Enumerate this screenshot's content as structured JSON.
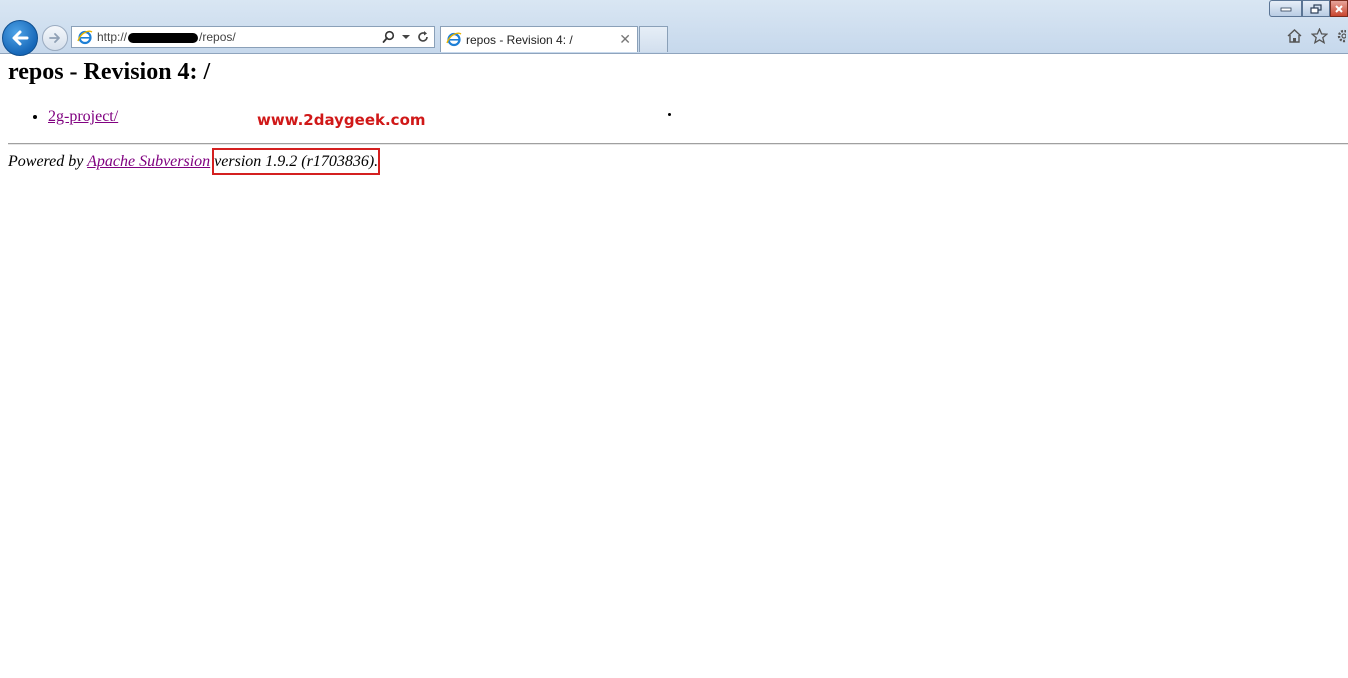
{
  "browser": {
    "address": {
      "prefix": "http://",
      "suffix": "/repos/"
    },
    "tab": {
      "title": "repos - Revision 4: /",
      "close_glyph": "✕"
    },
    "icons": [
      "back-arrow-icon",
      "forward-arrow-icon",
      "ie-page-icon",
      "search-icon",
      "dropdown-icon",
      "refresh-icon",
      "home-icon",
      "star-icon",
      "gear-icon",
      "minimize-icon",
      "maximize-icon",
      "close-icon"
    ]
  },
  "page": {
    "title": "repos - Revision 4: /",
    "entries": [
      {
        "label": "2g-project/"
      }
    ],
    "watermark": "www.2daygeek.com",
    "footer": {
      "prefix": "Powered by ",
      "link": "Apache Subversion",
      "version": " version 1.9.2 (r1703836)."
    },
    "colors": {
      "visited_link": "#800080",
      "watermark": "#d01818",
      "highlight_box": "#d42020"
    }
  }
}
